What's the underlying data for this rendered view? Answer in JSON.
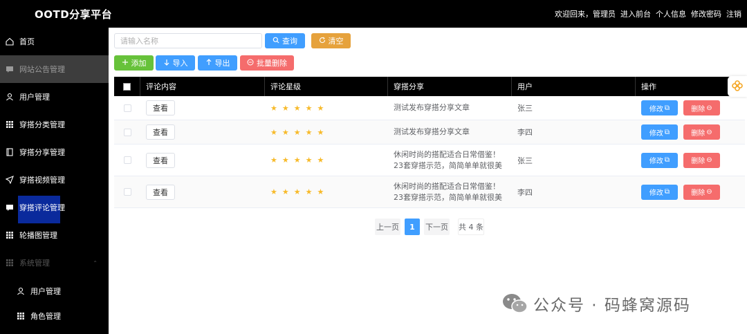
{
  "header": {
    "brand": "OOTD分享平台",
    "nav": [
      "欢迎回来，管理员",
      "进入前台",
      "个人信息",
      "修改密码",
      "注销"
    ]
  },
  "sidebar": {
    "items": [
      {
        "label": "首页",
        "icon": "home-icon"
      },
      {
        "label": "网站公告管理",
        "icon": "notice-icon"
      },
      {
        "label": "用户管理",
        "icon": "user-icon"
      },
      {
        "label": "穿搭分类管理",
        "icon": "grid-icon"
      },
      {
        "label": "穿搭分享管理",
        "icon": "book-icon"
      },
      {
        "label": "穿搭视频管理",
        "icon": "send-icon"
      },
      {
        "label": "穿搭评论管理",
        "icon": "comment-icon"
      },
      {
        "label": "轮播图管理",
        "icon": "grid-icon"
      },
      {
        "label": "系统管理",
        "icon": "grid-icon"
      },
      {
        "label": "用户管理",
        "icon": "user-icon"
      },
      {
        "label": "角色管理",
        "icon": "grid-icon"
      }
    ]
  },
  "toolbar": {
    "search_placeholder": "请输入名称",
    "query_label": "查询",
    "clear_label": "清空",
    "add_label": "添加",
    "import_label": "导入",
    "export_label": "导出",
    "batch_delete_label": "批量删除"
  },
  "table": {
    "headers": [
      "评论内容",
      "评论星级",
      "穿搭分享",
      "用户",
      "操作"
    ],
    "view_label": "查看",
    "edit_label": "修改",
    "delete_label": "删除",
    "rows": [
      {
        "stars": 5,
        "share": "测试发布穿搭分享文章",
        "user": "张三"
      },
      {
        "stars": 5,
        "share": "测试发布穿搭分享文章",
        "user": "李四"
      },
      {
        "stars": 5,
        "share": "休闲时尚的搭配适合日常借鉴！23套穿搭示范，简简单单就很美",
        "user": "张三"
      },
      {
        "stars": 5,
        "share": "休闲时尚的搭配适合日常借鉴！23套穿搭示范，简简单单就很美",
        "user": "李四"
      }
    ]
  },
  "pagination": {
    "prev": "上一页",
    "current": "1",
    "next": "下一页",
    "total": "共 4 条"
  },
  "watermark": {
    "text": "公众号 · 码蜂窝源码"
  },
  "colors": {
    "primary": "#409eff",
    "warning": "#e6a23c",
    "success": "#67c23a",
    "danger": "#f56c6c",
    "star": "#f7ba2a",
    "active_menu": "#0a2a9c"
  }
}
